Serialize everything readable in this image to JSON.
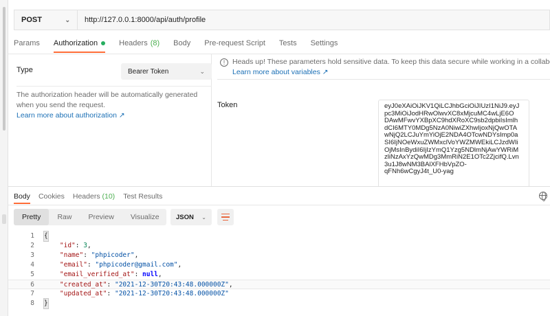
{
  "request": {
    "method": "POST",
    "url": "http://127.0.0.1:8000/api/auth/profile"
  },
  "request_tabs": {
    "params": "Params",
    "authorization": "Authorization",
    "headers": "Headers",
    "headers_count": "(8)",
    "body": "Body",
    "prerequest": "Pre-request Script",
    "tests": "Tests",
    "settings": "Settings"
  },
  "auth": {
    "type_label": "Type",
    "type_value": "Bearer Token",
    "description": "The authorization header will be automatically generated when you send the request.",
    "learn_link": "Learn more about authorization ↗",
    "notice_text": "Heads up! These parameters hold sensitive data. To keep this data secure while working in a collaborat",
    "notice_link": "Learn more about variables ↗",
    "token_label": "Token",
    "token_lines": [
      "eyJ0eXAiOiJKV1QiLCJhbGciOiJIUzI1NiJ9.eyJ",
      "pc3MiOiJodHRwOlwvXC8xMjcuMC4wLjE6O",
      "DAwMFwvYXBpXC9hdXRoXC9sb2dpbiIsImlh",
      "dCI6MTY0MDg5NzA0NiwiZXhwIjoxNjQwOTA",
      "wNjQ2LCJuYmYiOjE2NDA4OTcwNDYsImp0a",
      "SI6IjNOeWxuZWMxclVoYWZMWEkiLCJzdWIi",
      "OjMsInBydiI6IjIzYmQ1Yzg5NDlmNjAwYWRiM",
      "zliNzAxYzQwMDg3MmRiN2E1OTc2ZjcifQ.Lvn",
      "3u1J8wNM3BAlXFHbVpZO-",
      "qFNh6wCgyJ4t_U0-yag"
    ]
  },
  "response_tabs": {
    "body": "Body",
    "cookies": "Cookies",
    "headers": "Headers",
    "headers_count": "(10)",
    "test_results": "Test Results"
  },
  "view": {
    "pretty": "Pretty",
    "raw": "Raw",
    "preview": "Preview",
    "visualize": "Visualize",
    "format": "JSON"
  },
  "response_body": {
    "line_numbers": [
      "1",
      "2",
      "3",
      "4",
      "5",
      "6",
      "7",
      "8"
    ],
    "open_brace": "{",
    "close_brace": "}",
    "fields": [
      {
        "key": "\"id\"",
        "value": "3",
        "kind": "n",
        "comma": ","
      },
      {
        "key": "\"name\"",
        "value": "\"phpicoder\"",
        "kind": "s",
        "comma": ","
      },
      {
        "key": "\"email\"",
        "value": "\"phpicoder@gmail.com\"",
        "kind": "s",
        "comma": ","
      },
      {
        "key": "\"email_verified_at\"",
        "value": "null",
        "kind": "kw",
        "comma": ","
      },
      {
        "key": "\"created_at\"",
        "value": "\"2021-12-30T20:43:48.000000Z\"",
        "kind": "s",
        "comma": ","
      },
      {
        "key": "\"updated_at\"",
        "value": "\"2021-12-30T20:43:48.000000Z\"",
        "kind": "s",
        "comma": ""
      }
    ]
  },
  "colors": {
    "accent": "#ff6c37",
    "link": "#1a6fb5",
    "status_dot": "#27ae60"
  }
}
